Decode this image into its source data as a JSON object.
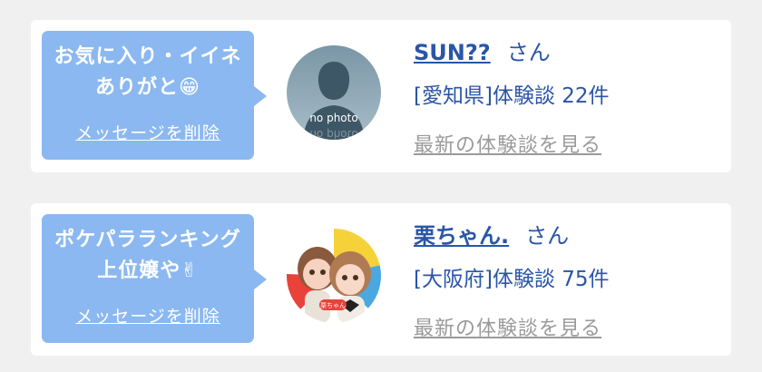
{
  "cards": [
    {
      "message": "お気に入り・イイネありがと😁",
      "delete_label": "メッセージを削除",
      "avatar": {
        "type": "no-photo",
        "caption": "no photo"
      },
      "name": "SUN??",
      "honorific": "さん",
      "experience": "[愛知県]体験談 22件",
      "latest_link": "最新の体験談を見る"
    },
    {
      "message": "ポケパラランキング上位嬢や✌",
      "delete_label": "メッセージを削除",
      "avatar": {
        "type": "photo",
        "caption": "栗ちゃん"
      },
      "name": "栗ちゃん.",
      "honorific": "さん",
      "experience": "[大阪府]体験談 75件",
      "latest_link": "最新の体験談を見る"
    }
  ],
  "colors": {
    "bubble": "#8bb8f0",
    "link": "#2a55a8",
    "muted_link": "#9a9a9a",
    "background": "#f0f0f0"
  }
}
